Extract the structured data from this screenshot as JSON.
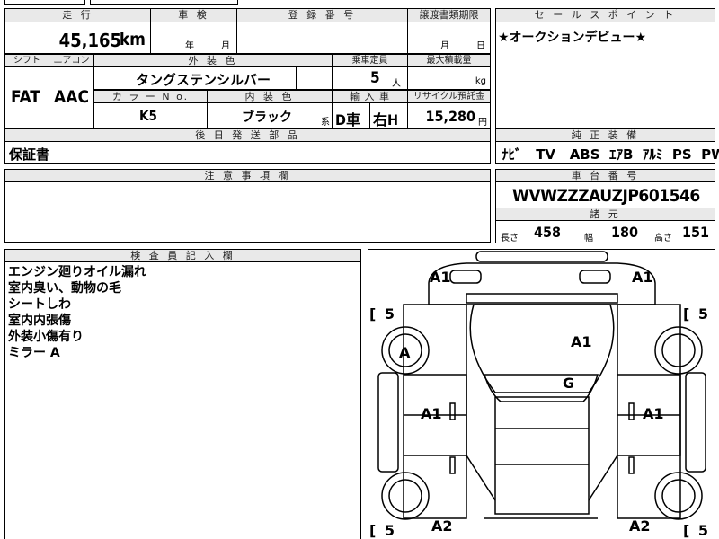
{
  "top_row": {
    "mileage_label": "走 行",
    "inspection_label": "車 検",
    "registration_label": "登 録 番 号",
    "transfer_label": "譲渡書類期限",
    "sales_point_label": "セ ー ル ス ポ イ ン ト"
  },
  "mileage": {
    "value": "45,165",
    "unit": "km"
  },
  "inspection": {
    "year_unit": "年",
    "month_unit": "月"
  },
  "transfer": {
    "month_unit": "月",
    "day_unit": "日"
  },
  "sales_point": {
    "text": "★オークションデビュー★"
  },
  "row2": {
    "shift_label": "シフト",
    "aircon_label": "エアコン",
    "exterior_color_label": "外 装 色",
    "capacity_label": "乗車定員",
    "max_load_label": "最大積載量",
    "shift": "FAT",
    "aircon": "AAC",
    "exterior_color": "タングステンシルバー",
    "capacity_value": "5",
    "capacity_unit": "人",
    "max_load_unit": "kg",
    "color_no_label": "カ ラ ー N o.",
    "interior_color_label": "内 装 色",
    "import_label": "輸 入 車",
    "recycle_label": "リサイクル預託金",
    "color_no": "K5",
    "interior_color": "ブラック",
    "interior_suffix": "系",
    "import_type": "D車",
    "handle": "右H",
    "recycle_value": "15,280",
    "recycle_unit": "円"
  },
  "later_parts": {
    "label": "後 日 発 送 部 品",
    "value": "保証書"
  },
  "equipment": {
    "label": "純 正 装 備",
    "items": [
      "ﾅﾋﾞ",
      "TV",
      "ABS",
      "ｴｱB",
      "ｱﾙﾐ",
      "PS",
      "PW"
    ]
  },
  "notes": {
    "label": "注 意 事 項 欄"
  },
  "chassis": {
    "label": "車 台 番 号",
    "value": "WVWZZZAUZJP601546"
  },
  "dimensions": {
    "label": "諸 元",
    "length_label": "長さ",
    "length": "458",
    "width_label": "幅",
    "width": "180",
    "height_label": "高さ",
    "height": "151"
  },
  "inspector": {
    "label": "検 査 員 記 入 欄",
    "lines": [
      "エンジン廻りオイル漏れ",
      "室内臭い、動物の毛",
      "シートしわ",
      "室内内張傷",
      "外装小傷有り",
      "ミラー A"
    ]
  },
  "car_map": {
    "marks": {
      "front_left": "A1",
      "front_right": "A1",
      "hood": "A1",
      "wheel_fl": "A",
      "windshield": "G",
      "door_left": "A1",
      "door_right": "A1",
      "rear_left": "A2",
      "rear_right": "A2"
    },
    "tread": {
      "fl": "5",
      "fr": "5",
      "rl": "5",
      "rr": "5"
    }
  }
}
